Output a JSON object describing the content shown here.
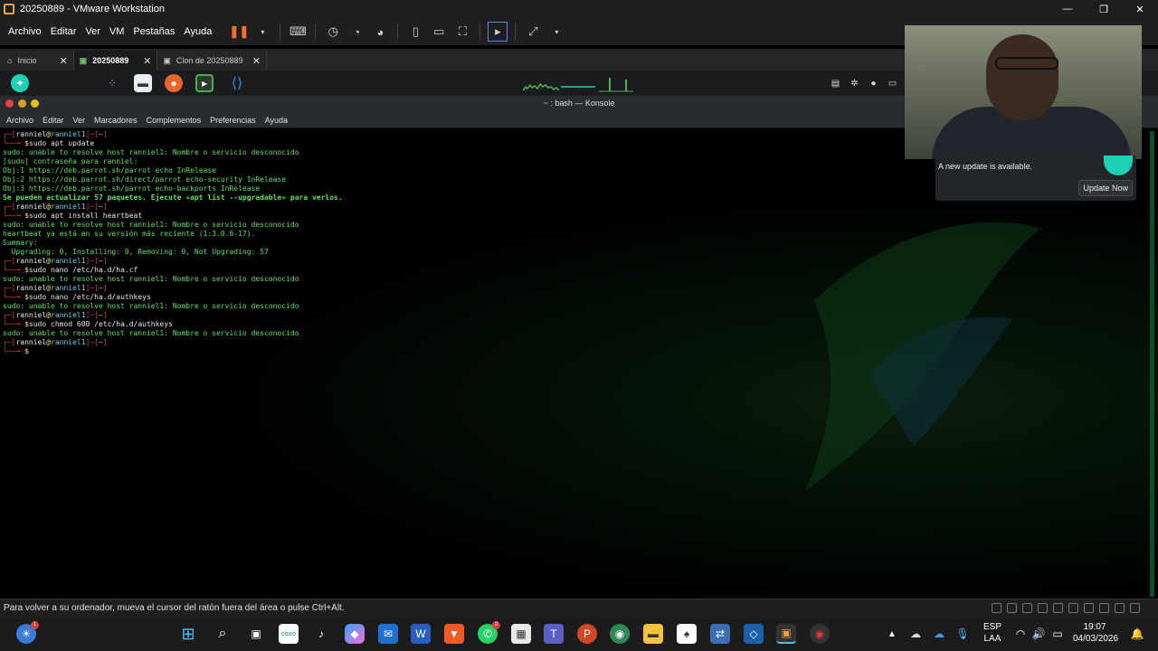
{
  "window": {
    "title": "20250889 - VMware Workstation"
  },
  "vm_menu": [
    "Archivo",
    "Editar",
    "Ver",
    "VM",
    "Pestañas",
    "Ayuda"
  ],
  "tabs": [
    {
      "label": "Inicio",
      "icon": "home-icon"
    },
    {
      "label": "20250889",
      "icon": "vm-icon",
      "active": true
    },
    {
      "label": "Clon de 20250889",
      "icon": "vm-icon"
    }
  ],
  "konsole": {
    "title": "~ : bash — Konsole",
    "menu": [
      "Archivo",
      "Editar",
      "Ver",
      "Marcadores",
      "Complementos",
      "Preferencias",
      "Ayuda"
    ]
  },
  "terminal": {
    "user": "ranniel",
    "host": "ranniel1",
    "dir": "~",
    "lines": [
      {
        "type": "prompt"
      },
      {
        "type": "cmd",
        "text": "sudo apt update"
      },
      {
        "type": "out",
        "text": "sudo: unable to resolve host ranniel1: Nombre o servicio desconocido"
      },
      {
        "type": "out",
        "text": "[sudo] contraseña para ranniel:"
      },
      {
        "type": "out",
        "text": "Obj:1 https://deb.parrot.sh/parrot echo InRelease"
      },
      {
        "type": "out",
        "text": "Obj:2 https://deb.parrot.sh/direct/parrot echo-security InRelease"
      },
      {
        "type": "out",
        "text": "Obj:3 https://deb.parrot.sh/parrot echo-backports InRelease"
      },
      {
        "type": "bold",
        "text": "Se pueden actualizar 57 paquetes. Ejecute «apt list --upgradable» para verlos."
      },
      {
        "type": "prompt"
      },
      {
        "type": "cmd",
        "text": "sudo apt install heartbeat"
      },
      {
        "type": "out",
        "text": "sudo: unable to resolve host ranniel1: Nombre o servicio desconocido"
      },
      {
        "type": "out",
        "text": "heartbeat ya está en su versión más reciente (1:3.0.6-17)."
      },
      {
        "type": "out",
        "text": "Summary:"
      },
      {
        "type": "out",
        "text": "  Upgrading: 0, Installing: 0, Removing: 0, Not Upgrading: 57"
      },
      {
        "type": "prompt"
      },
      {
        "type": "cmd",
        "text": "sudo nano /etc/ha.d/ha.cf"
      },
      {
        "type": "out",
        "text": "sudo: unable to resolve host ranniel1: Nombre o servicio desconocido"
      },
      {
        "type": "prompt"
      },
      {
        "type": "cmd",
        "text": "sudo nano /etc/ha.d/authkeys"
      },
      {
        "type": "out",
        "text": "sudo: unable to resolve host ranniel1: Nombre o servicio desconocido"
      },
      {
        "type": "prompt"
      },
      {
        "type": "cmd",
        "text": "sudo chmod 600 /etc/ha.d/authkeys"
      },
      {
        "type": "out",
        "text": "sudo: unable to resolve host ranniel1: Nombre o servicio desconocido"
      },
      {
        "type": "prompt"
      },
      {
        "type": "cmd",
        "text": ""
      }
    ]
  },
  "notification": {
    "message": "A new update is available.",
    "button": "Update Now"
  },
  "status_bar": {
    "text": "Para volver a su ordenador, mueva el cursor del ratón fuera del área o pulse Ctrl+Alt."
  },
  "taskbar": {
    "language": "ESP",
    "layout": "LAA",
    "time": "19:07",
    "date": "04/03/2026",
    "whatsapp_badge": "2",
    "widgets_badge": "1"
  },
  "colors": {
    "prompt_bracket": "#d53a3a",
    "prompt_user": "#e8e8e8",
    "prompt_at": "#f4e542",
    "prompt_host": "#5ad8f2",
    "output": "#54e35f",
    "pause_icon": "#f0702c"
  }
}
